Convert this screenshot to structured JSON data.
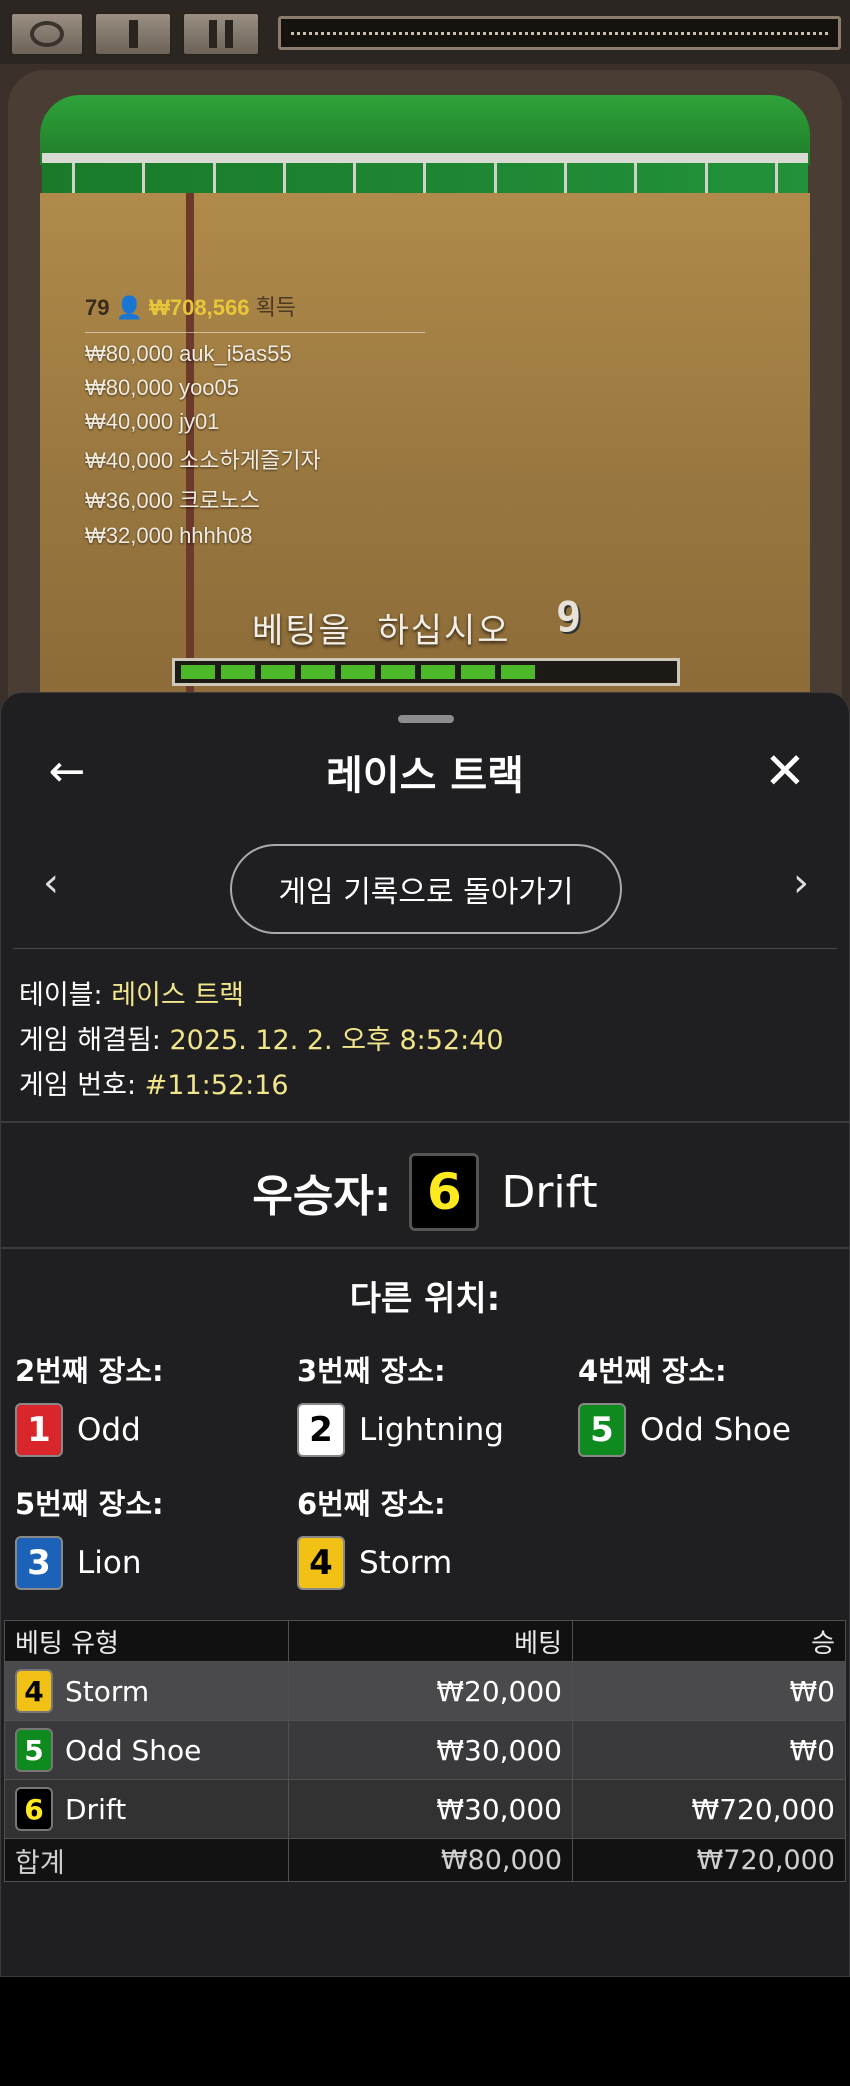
{
  "game": {
    "leader": {
      "count": "79",
      "total": "₩708,566",
      "suffix": "획득",
      "rows": [
        {
          "amount": "₩80,000",
          "user": "auk_i5as55"
        },
        {
          "amount": "₩80,000",
          "user": "yoo05"
        },
        {
          "amount": "₩40,000",
          "user": "jy01"
        },
        {
          "amount": "₩40,000",
          "user": "소소하게즐기자"
        },
        {
          "amount": "₩36,000",
          "user": "크로노스"
        },
        {
          "amount": "₩32,000",
          "user": "hhhh08"
        }
      ]
    },
    "bet_message": "베팅을  하십시오",
    "countdown": "9",
    "betting_timer_progress": 0.75,
    "icons": {
      "settings": "camera-icon",
      "pause1": "single-bar-icon",
      "pause2": "pause-icon"
    }
  },
  "sheet": {
    "title": "레이스 트랙",
    "history_button": "게임 기록으로 돌아가기",
    "info": {
      "table_label": "테이블:",
      "table_value": "레이스 트랙",
      "resolved_label": "게임 해결됨:",
      "resolved_value": "2025. 12. 2. 오후 8:52:40",
      "number_label": "게임 번호:",
      "number_value": "#11:52:16"
    },
    "winner": {
      "label": "우승자:",
      "number": "6",
      "name": "Drift",
      "color": "#000000"
    },
    "others_title": "다른 위치:",
    "places": [
      {
        "label": "2번째 장소:",
        "number": "1",
        "name": "Odd",
        "color": "#d8262b"
      },
      {
        "label": "3번째 장소:",
        "number": "2",
        "name": "Lightning",
        "color": "#ffffff"
      },
      {
        "label": "4번째 장소:",
        "number": "5",
        "name": "Odd Shoe",
        "color": "#0f8a1f"
      },
      {
        "label": "5번째 장소:",
        "number": "3",
        "name": "Lion",
        "color": "#1b62b8"
      },
      {
        "label": "6번째 장소:",
        "number": "4",
        "name": "Storm",
        "color": "#f2c116"
      }
    ],
    "table": {
      "headers": [
        "베팅 유형",
        "베팅",
        "승"
      ],
      "rows": [
        {
          "number": "4",
          "name": "Storm",
          "bet": "₩20,000",
          "win": "₩0"
        },
        {
          "number": "5",
          "name": "Odd Shoe",
          "bet": "₩30,000",
          "win": "₩0"
        },
        {
          "number": "6",
          "name": "Drift",
          "bet": "₩30,000",
          "win": "₩720,000"
        }
      ],
      "total": {
        "label": "합계",
        "bet": "₩80,000",
        "win": "₩720,000"
      }
    }
  }
}
